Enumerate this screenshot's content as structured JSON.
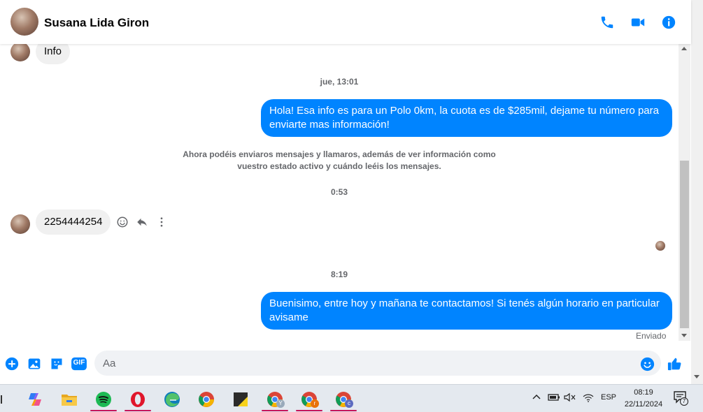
{
  "header": {
    "contact_name": "Susana Lida Giron",
    "icons": [
      "phone-icon",
      "video-camera-icon",
      "info-icon"
    ],
    "accent_color": "#0084ff"
  },
  "messages": {
    "incoming_1": "Info",
    "timestamp_1": "jue, 13:01",
    "outgoing_1": "Hola! Esa info es para un Polo 0km, la cuota es de $285mil, dejame tu número para enviarte mas información!",
    "notice": "Ahora podéis enviaros mensajes y llamaros, además de ver información como vuestro estado activo y cuándo leéis los mensajes.",
    "timestamp_2": "0:53",
    "incoming_2": "2254444254",
    "timestamp_3": "8:19",
    "outgoing_2": "Buenisimo, entre hoy y mañana te contactamos! Si tenés algún horario en particular avisame",
    "status": "Enviado"
  },
  "composer": {
    "placeholder": "Aa",
    "icons": [
      "plus-icon",
      "photo-icon",
      "sticker-icon",
      "gif-icon",
      "emoji-icon",
      "like-icon"
    ],
    "gif_label": "GIF"
  },
  "taskbar": {
    "apps": [
      "copilot",
      "file-explorer",
      "spotify",
      "opera",
      "edge",
      "chrome",
      "sticky-notes",
      "chrome-profile-y",
      "chrome-profile-r",
      "chrome-profile-c"
    ],
    "profile_letters": [
      "Y",
      "r",
      "c"
    ],
    "language": "ESP",
    "time": "08:19",
    "date": "22/11/2024",
    "notification_count": "7"
  }
}
